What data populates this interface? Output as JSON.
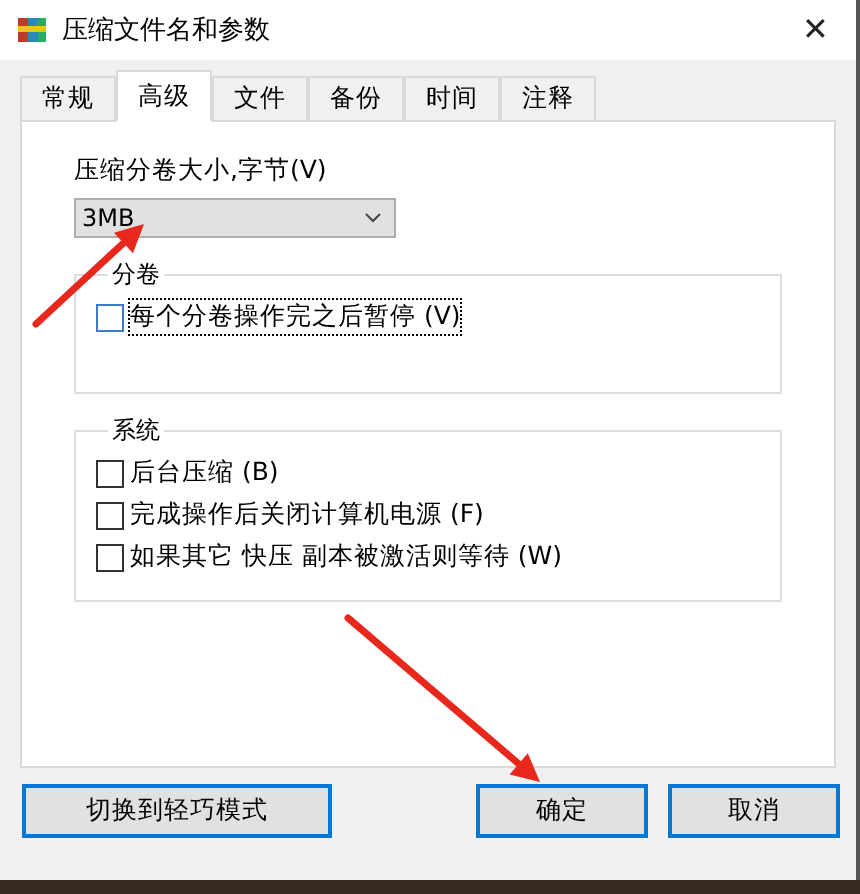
{
  "window": {
    "title": "压缩文件名和参数",
    "close": "✕"
  },
  "tabs": [
    {
      "label": "常规",
      "selected": false
    },
    {
      "label": "高级",
      "selected": true
    },
    {
      "label": "文件",
      "selected": false
    },
    {
      "label": "备份",
      "selected": false
    },
    {
      "label": "时间",
      "selected": false
    },
    {
      "label": "注释",
      "selected": false
    }
  ],
  "volume_size": {
    "label": "压缩分卷大小,字节(V)",
    "value": "3MB"
  },
  "groups": [
    {
      "title": "分卷",
      "options": [
        {
          "label": "每个分卷操作完之后暂停 (V)",
          "checked": false,
          "focused": true
        }
      ]
    },
    {
      "title": "系统",
      "options": [
        {
          "label": "后台压缩 (B)",
          "checked": false,
          "focused": false
        },
        {
          "label": "完成操作后关闭计算机电源 (F)",
          "checked": false,
          "focused": false
        },
        {
          "label": "如果其它 快压 副本被激活则等待 (W)",
          "checked": false,
          "focused": false
        }
      ]
    }
  ],
  "buttons": [
    {
      "label": "切换到轻巧模式"
    },
    {
      "label": "确定"
    },
    {
      "label": "取消"
    }
  ],
  "annotations": [
    {
      "kind": "arrow"
    },
    {
      "kind": "arrow"
    }
  ]
}
